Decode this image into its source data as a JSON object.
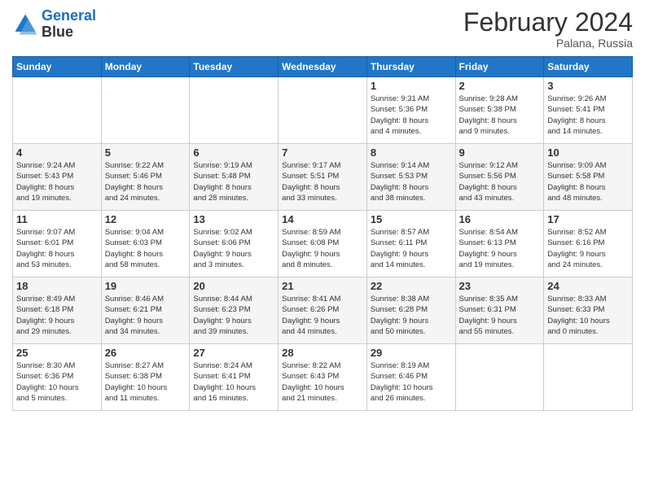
{
  "logo": {
    "line1": "General",
    "line2": "Blue"
  },
  "title": "February 2024",
  "subtitle": "Palana, Russia",
  "weekdays": [
    "Sunday",
    "Monday",
    "Tuesday",
    "Wednesday",
    "Thursday",
    "Friday",
    "Saturday"
  ],
  "weeks": [
    [
      {
        "day": "",
        "info": ""
      },
      {
        "day": "",
        "info": ""
      },
      {
        "day": "",
        "info": ""
      },
      {
        "day": "",
        "info": ""
      },
      {
        "day": "1",
        "info": "Sunrise: 9:31 AM\nSunset: 5:36 PM\nDaylight: 8 hours\nand 4 minutes."
      },
      {
        "day": "2",
        "info": "Sunrise: 9:28 AM\nSunset: 5:38 PM\nDaylight: 8 hours\nand 9 minutes."
      },
      {
        "day": "3",
        "info": "Sunrise: 9:26 AM\nSunset: 5:41 PM\nDaylight: 8 hours\nand 14 minutes."
      }
    ],
    [
      {
        "day": "4",
        "info": "Sunrise: 9:24 AM\nSunset: 5:43 PM\nDaylight: 8 hours\nand 19 minutes."
      },
      {
        "day": "5",
        "info": "Sunrise: 9:22 AM\nSunset: 5:46 PM\nDaylight: 8 hours\nand 24 minutes."
      },
      {
        "day": "6",
        "info": "Sunrise: 9:19 AM\nSunset: 5:48 PM\nDaylight: 8 hours\nand 28 minutes."
      },
      {
        "day": "7",
        "info": "Sunrise: 9:17 AM\nSunset: 5:51 PM\nDaylight: 8 hours\nand 33 minutes."
      },
      {
        "day": "8",
        "info": "Sunrise: 9:14 AM\nSunset: 5:53 PM\nDaylight: 8 hours\nand 38 minutes."
      },
      {
        "day": "9",
        "info": "Sunrise: 9:12 AM\nSunset: 5:56 PM\nDaylight: 8 hours\nand 43 minutes."
      },
      {
        "day": "10",
        "info": "Sunrise: 9:09 AM\nSunset: 5:58 PM\nDaylight: 8 hours\nand 48 minutes."
      }
    ],
    [
      {
        "day": "11",
        "info": "Sunrise: 9:07 AM\nSunset: 6:01 PM\nDaylight: 8 hours\nand 53 minutes."
      },
      {
        "day": "12",
        "info": "Sunrise: 9:04 AM\nSunset: 6:03 PM\nDaylight: 8 hours\nand 58 minutes."
      },
      {
        "day": "13",
        "info": "Sunrise: 9:02 AM\nSunset: 6:06 PM\nDaylight: 9 hours\nand 3 minutes."
      },
      {
        "day": "14",
        "info": "Sunrise: 8:59 AM\nSunset: 6:08 PM\nDaylight: 9 hours\nand 8 minutes."
      },
      {
        "day": "15",
        "info": "Sunrise: 8:57 AM\nSunset: 6:11 PM\nDaylight: 9 hours\nand 14 minutes."
      },
      {
        "day": "16",
        "info": "Sunrise: 8:54 AM\nSunset: 6:13 PM\nDaylight: 9 hours\nand 19 minutes."
      },
      {
        "day": "17",
        "info": "Sunrise: 8:52 AM\nSunset: 6:16 PM\nDaylight: 9 hours\nand 24 minutes."
      }
    ],
    [
      {
        "day": "18",
        "info": "Sunrise: 8:49 AM\nSunset: 6:18 PM\nDaylight: 9 hours\nand 29 minutes."
      },
      {
        "day": "19",
        "info": "Sunrise: 8:46 AM\nSunset: 6:21 PM\nDaylight: 9 hours\nand 34 minutes."
      },
      {
        "day": "20",
        "info": "Sunrise: 8:44 AM\nSunset: 6:23 PM\nDaylight: 9 hours\nand 39 minutes."
      },
      {
        "day": "21",
        "info": "Sunrise: 8:41 AM\nSunset: 6:26 PM\nDaylight: 9 hours\nand 44 minutes."
      },
      {
        "day": "22",
        "info": "Sunrise: 8:38 AM\nSunset: 6:28 PM\nDaylight: 9 hours\nand 50 minutes."
      },
      {
        "day": "23",
        "info": "Sunrise: 8:35 AM\nSunset: 6:31 PM\nDaylight: 9 hours\nand 55 minutes."
      },
      {
        "day": "24",
        "info": "Sunrise: 8:33 AM\nSunset: 6:33 PM\nDaylight: 10 hours\nand 0 minutes."
      }
    ],
    [
      {
        "day": "25",
        "info": "Sunrise: 8:30 AM\nSunset: 6:36 PM\nDaylight: 10 hours\nand 5 minutes."
      },
      {
        "day": "26",
        "info": "Sunrise: 8:27 AM\nSunset: 6:38 PM\nDaylight: 10 hours\nand 11 minutes."
      },
      {
        "day": "27",
        "info": "Sunrise: 8:24 AM\nSunset: 6:41 PM\nDaylight: 10 hours\nand 16 minutes."
      },
      {
        "day": "28",
        "info": "Sunrise: 8:22 AM\nSunset: 6:43 PM\nDaylight: 10 hours\nand 21 minutes."
      },
      {
        "day": "29",
        "info": "Sunrise: 8:19 AM\nSunset: 6:46 PM\nDaylight: 10 hours\nand 26 minutes."
      },
      {
        "day": "",
        "info": ""
      },
      {
        "day": "",
        "info": ""
      }
    ]
  ]
}
